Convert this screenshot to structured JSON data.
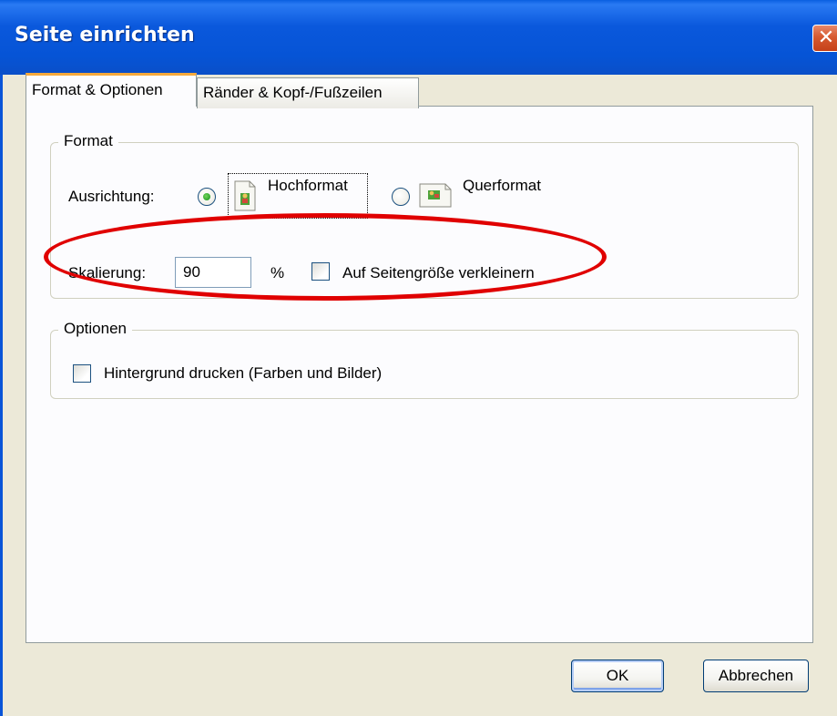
{
  "window": {
    "title": "Seite einrichten",
    "close_glyph": "✕"
  },
  "tabs": [
    {
      "label": "Format & Optionen",
      "active": true
    },
    {
      "label": "Ränder & Kopf-/Fußzeilen",
      "active": false
    }
  ],
  "format_group": {
    "legend": "Format",
    "orientation_label": "Ausrichtung:",
    "portrait_label": "Hochformat",
    "landscape_label": "Querformat",
    "selected_orientation": "Hochformat",
    "scaling_label": "Skalierung:",
    "scaling_value": "90",
    "percent_sign": "%",
    "shrink_label": "Auf Seitengröße verkleinern",
    "shrink_checked": false
  },
  "options_group": {
    "legend": "Optionen",
    "print_background_label": "Hintergrund drucken (Farben und Bilder)",
    "print_background_checked": false
  },
  "buttons": {
    "ok_label": "OK",
    "cancel_label": "Abbrechen"
  },
  "icons": [
    "portrait-page-icon",
    "landscape-page-icon",
    "close-icon"
  ],
  "colors": {
    "titlebar": "#0a58dc",
    "tab_accent": "#f6a93b",
    "annotation": "#e00000",
    "radio_dot": "#2ca52c"
  }
}
